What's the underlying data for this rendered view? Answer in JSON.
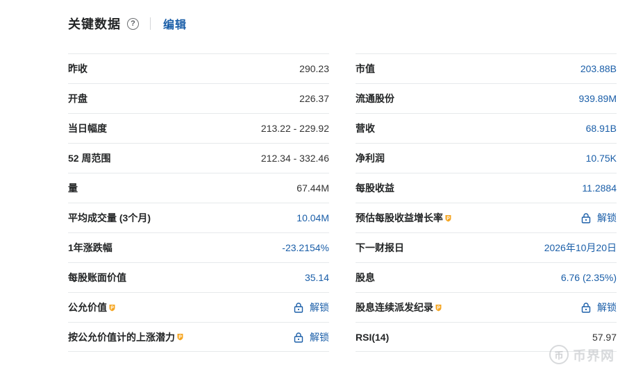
{
  "header": {
    "title": "关键数据",
    "help_icon": "?",
    "edit_label": "编辑"
  },
  "left_rows": [
    {
      "label": "昨收",
      "value": "290.23",
      "style": "plain"
    },
    {
      "label": "开盘",
      "value": "226.37",
      "style": "plain"
    },
    {
      "label": "当日幅度",
      "value": "213.22 - 229.92",
      "style": "plain"
    },
    {
      "label": "52 周范围",
      "value": "212.34 - 332.46",
      "style": "plain"
    },
    {
      "label": "量",
      "value": "67.44M",
      "style": "plain"
    },
    {
      "label": "平均成交量 (3个月)",
      "value": "10.04M",
      "style": "link"
    },
    {
      "label": "1年涨跌幅",
      "value": "-23.2154%",
      "style": "link"
    },
    {
      "label": "每股账面价值",
      "value": "35.14",
      "style": "link"
    },
    {
      "label": "公允价值",
      "value": "解锁",
      "style": "locked",
      "pro": true
    },
    {
      "label": "按公允价值计的上涨潜力",
      "value": "解锁",
      "style": "locked",
      "pro": true
    }
  ],
  "right_rows": [
    {
      "label": "市值",
      "value": "203.88B",
      "style": "link"
    },
    {
      "label": "流通股份",
      "value": "939.89M",
      "style": "link"
    },
    {
      "label": "营收",
      "value": "68.91B",
      "style": "link"
    },
    {
      "label": "净利润",
      "value": "10.75K",
      "style": "link"
    },
    {
      "label": "每股收益",
      "value": "11.2884",
      "style": "link"
    },
    {
      "label": "预估每股收益增长率",
      "value": "解锁",
      "style": "locked",
      "pro": true
    },
    {
      "label": "下一财报日",
      "value": "2026年10月20日",
      "style": "link"
    },
    {
      "label": "股息",
      "value": "6.76 (2.35%)",
      "style": "link"
    },
    {
      "label": "股息连续派发纪录",
      "value": "解锁",
      "style": "locked",
      "pro": true
    },
    {
      "label": "RSI(14)",
      "value": "57.97",
      "style": "plain"
    }
  ],
  "watermark": {
    "logo_text": "币",
    "text": "币界网"
  },
  "colors": {
    "link": "#1a5ea8",
    "pro_badge": "#f5a623",
    "divider": "#e6e9eb"
  },
  "icons": {
    "lock": "lock-icon",
    "pro": "pro-badge-icon",
    "help": "question-circle-icon"
  }
}
